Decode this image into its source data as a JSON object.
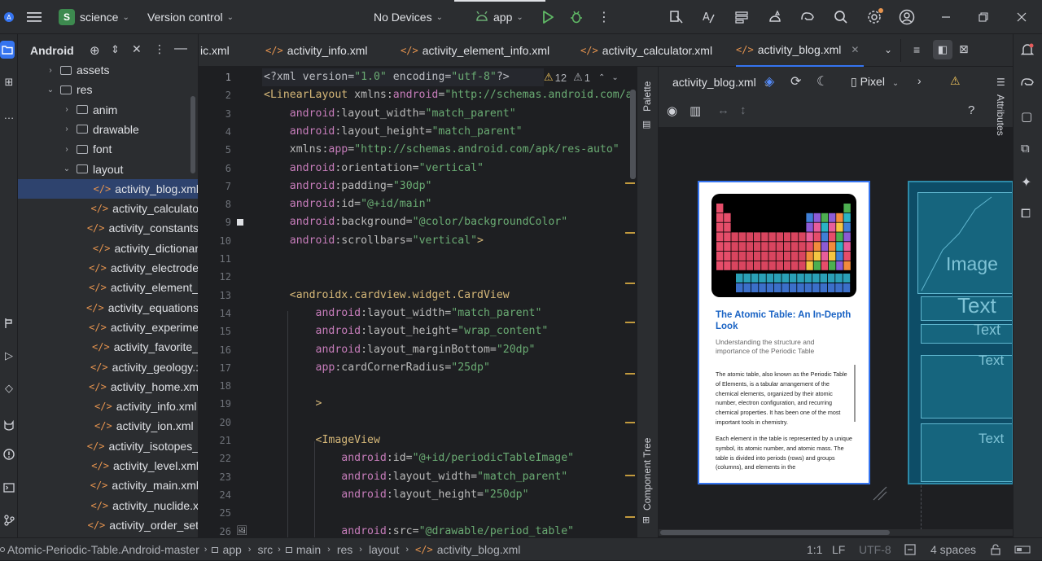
{
  "titlebar": {
    "project_badge": "S",
    "project_name": "science",
    "vcs": "Version control",
    "device": "No Devices",
    "run_config": "app"
  },
  "project_panel": {
    "title": "Android",
    "tree": [
      {
        "label": "assets",
        "type": "folder",
        "arrow": "›",
        "indent": 1
      },
      {
        "label": "res",
        "type": "folder",
        "arrow": "⌄",
        "indent": 1
      },
      {
        "label": "anim",
        "type": "folder",
        "arrow": "›",
        "indent": 2
      },
      {
        "label": "drawable",
        "type": "folder",
        "arrow": "›",
        "indent": 2
      },
      {
        "label": "font",
        "type": "folder",
        "arrow": "›",
        "indent": 2
      },
      {
        "label": "layout",
        "type": "folder",
        "arrow": "⌄",
        "indent": 2
      },
      {
        "label": "activity_blog.xml",
        "type": "xml",
        "selected": true
      },
      {
        "label": "activity_calculato",
        "type": "xml"
      },
      {
        "label": "activity_constants",
        "type": "xml"
      },
      {
        "label": "activity_dictionar",
        "type": "xml"
      },
      {
        "label": "activity_electrode",
        "type": "xml"
      },
      {
        "label": "activity_element_",
        "type": "xml"
      },
      {
        "label": "activity_equations",
        "type": "xml"
      },
      {
        "label": "activity_experime",
        "type": "xml"
      },
      {
        "label": "activity_favorite_",
        "type": "xml"
      },
      {
        "label": "activity_geology.:",
        "type": "xml"
      },
      {
        "label": "activity_home.xm",
        "type": "xml"
      },
      {
        "label": "activity_info.xml",
        "type": "xml"
      },
      {
        "label": "activity_ion.xml",
        "type": "xml"
      },
      {
        "label": "activity_isotopes_",
        "type": "xml"
      },
      {
        "label": "activity_level.xml",
        "type": "xml"
      },
      {
        "label": "activity_main.xml",
        "type": "xml"
      },
      {
        "label": "activity_nuclide.x",
        "type": "xml"
      },
      {
        "label": "activity_order_set",
        "type": "xml"
      }
    ]
  },
  "tabs": [
    {
      "label": "ic.xml"
    },
    {
      "label": "activity_info.xml"
    },
    {
      "label": "activity_element_info.xml"
    },
    {
      "label": "activity_calculator.xml"
    },
    {
      "label": "activity_blog.xml",
      "active": true
    }
  ],
  "inspections": {
    "warnings": "12",
    "weak": "1"
  },
  "code_lines": [
    {
      "n": "1",
      "parts": [
        [
          "pi",
          "<?xml version="
        ],
        [
          "val",
          "\"1.0\""
        ],
        [
          "pi",
          " encoding="
        ],
        [
          "val",
          "\"utf-8\""
        ],
        [
          "pi",
          "?>"
        ]
      ]
    },
    {
      "n": "2",
      "parts": [
        [
          "tag",
          "<LinearLayout"
        ],
        [
          "attr",
          " xmlns:"
        ],
        [
          "ns",
          "android"
        ],
        [
          "attr",
          "="
        ],
        [
          "val",
          "\"http://schemas.android.com/a"
        ]
      ]
    },
    {
      "n": "3",
      "parts": [
        [
          "ns",
          "    android"
        ],
        [
          "attr",
          ":layout_width="
        ],
        [
          "val",
          "\"match_parent\""
        ]
      ]
    },
    {
      "n": "4",
      "parts": [
        [
          "ns",
          "    android"
        ],
        [
          "attr",
          ":layout_height="
        ],
        [
          "val",
          "\"match_parent\""
        ]
      ]
    },
    {
      "n": "5",
      "parts": [
        [
          "attr",
          "    xmlns:"
        ],
        [
          "ns",
          "app"
        ],
        [
          "attr",
          "="
        ],
        [
          "val",
          "\"http://schemas.android.com/apk/res-auto\""
        ]
      ]
    },
    {
      "n": "6",
      "parts": [
        [
          "ns",
          "    android"
        ],
        [
          "attr",
          ":orientation="
        ],
        [
          "val",
          "\"vertical\""
        ]
      ]
    },
    {
      "n": "7",
      "parts": [
        [
          "ns",
          "    android"
        ],
        [
          "attr",
          ":padding="
        ],
        [
          "val",
          "\"30dp\""
        ]
      ]
    },
    {
      "n": "8",
      "parts": [
        [
          "ns",
          "    android"
        ],
        [
          "attr",
          ":id="
        ],
        [
          "val",
          "\"@+id/main\""
        ]
      ]
    },
    {
      "n": "9",
      "parts": [
        [
          "ns",
          "    android"
        ],
        [
          "attr",
          ":background="
        ],
        [
          "val",
          "\"@color/backgroundColor\""
        ]
      ]
    },
    {
      "n": "10",
      "parts": [
        [
          "ns",
          "    android"
        ],
        [
          "attr",
          ":scrollbars="
        ],
        [
          "val",
          "\"vertical\""
        ],
        [
          "tag",
          ">"
        ]
      ]
    },
    {
      "n": "11",
      "parts": []
    },
    {
      "n": "12",
      "parts": []
    },
    {
      "n": "13",
      "parts": [
        [
          "tag",
          "    <androidx.cardview.widget.CardView"
        ]
      ]
    },
    {
      "n": "14",
      "parts": [
        [
          "ns",
          "        android"
        ],
        [
          "attr",
          ":layout_width="
        ],
        [
          "val",
          "\"match_parent\""
        ]
      ]
    },
    {
      "n": "15",
      "parts": [
        [
          "ns",
          "        android"
        ],
        [
          "attr",
          ":layout_height="
        ],
        [
          "val",
          "\"wrap_content\""
        ]
      ]
    },
    {
      "n": "16",
      "parts": [
        [
          "ns",
          "        android"
        ],
        [
          "attr",
          ":layout_marginBottom="
        ],
        [
          "val",
          "\"20dp\""
        ]
      ]
    },
    {
      "n": "17",
      "parts": [
        [
          "ns",
          "        app"
        ],
        [
          "attr",
          ":cardCornerRadius="
        ],
        [
          "val",
          "\"25dp\""
        ]
      ]
    },
    {
      "n": "18",
      "parts": []
    },
    {
      "n": "19",
      "parts": [
        [
          "tag",
          "        >"
        ]
      ]
    },
    {
      "n": "20",
      "parts": []
    },
    {
      "n": "21",
      "parts": [
        [
          "tag",
          "        <ImageView"
        ]
      ]
    },
    {
      "n": "22",
      "parts": [
        [
          "ns",
          "            android"
        ],
        [
          "attr",
          ":id="
        ],
        [
          "val",
          "\"@+id/periodicTableImage\""
        ]
      ]
    },
    {
      "n": "23",
      "parts": [
        [
          "ns",
          "            android"
        ],
        [
          "attr",
          ":layout_width="
        ],
        [
          "val",
          "\"match_parent\""
        ]
      ]
    },
    {
      "n": "24",
      "parts": [
        [
          "ns",
          "            android"
        ],
        [
          "attr",
          ":layout_height="
        ],
        [
          "val",
          "\"250dp\""
        ]
      ]
    },
    {
      "n": "25",
      "parts": []
    },
    {
      "n": "26",
      "parts": [
        [
          "ns",
          "            android"
        ],
        [
          "attr",
          ":src="
        ],
        [
          "val",
          "\"@drawable/period_table\""
        ]
      ]
    }
  ],
  "preview": {
    "file": "activity_blog.xml",
    "device": "Pixel",
    "palette_label": "Palette",
    "component_tree_label": "Component Tree",
    "attributes_label": "Attributes",
    "help": "?",
    "card_title": "The Atomic Table: An In-Depth Look",
    "card_subtitle": "Understanding the structure and importance of the Periodic Table",
    "paragraph1": "The atomic table, also known as the Periodic Table of Elements, is a tabular arrangement of the chemical elements, organized by their atomic number, electron configuration, and recurring chemical properties. It has been one of the most important tools in chemistry.",
    "paragraph2": "Each element in the table is represented by a unique symbol, its atomic number, and atomic mass. The table is divided into periods (rows) and groups (columns), and elements in the",
    "blueprint_labels": [
      "Image",
      "Text",
      "Text",
      "Text",
      "Text"
    ]
  },
  "statusbar": {
    "breadcrumb": [
      "Atomic-Periodic-Table.Android-master",
      "app",
      "src",
      "main",
      "res",
      "layout",
      "activity_blog.xml"
    ],
    "position": "1:1",
    "line_sep": "LF",
    "encoding": "UTF-8",
    "indent": "4 spaces"
  },
  "colors": {
    "accent": "#3574f0",
    "tag": "#d5b778",
    "namespace": "#c77dbb",
    "value": "#6aab73",
    "warning": "#f2c55c"
  }
}
